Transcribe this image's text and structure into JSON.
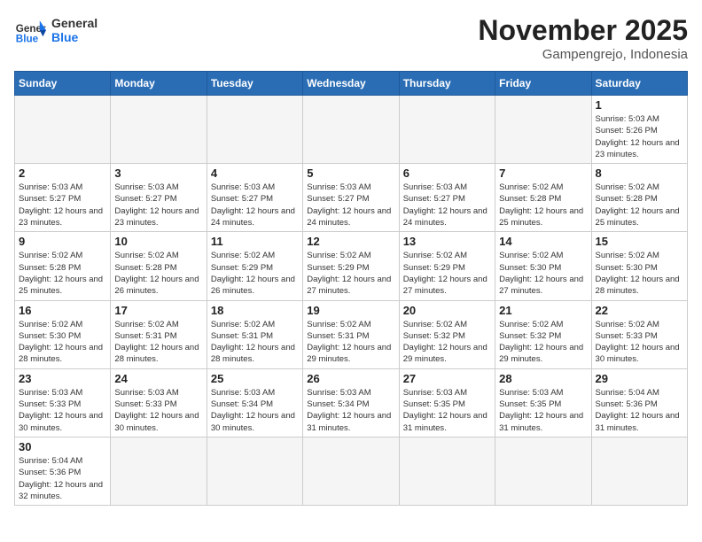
{
  "header": {
    "logo_general": "General",
    "logo_blue": "Blue",
    "month_title": "November 2025",
    "location": "Gampengrejo, Indonesia"
  },
  "days_of_week": [
    "Sunday",
    "Monday",
    "Tuesday",
    "Wednesday",
    "Thursday",
    "Friday",
    "Saturday"
  ],
  "weeks": [
    [
      {
        "day": "",
        "empty": true
      },
      {
        "day": "",
        "empty": true
      },
      {
        "day": "",
        "empty": true
      },
      {
        "day": "",
        "empty": true
      },
      {
        "day": "",
        "empty": true
      },
      {
        "day": "",
        "empty": true
      },
      {
        "day": "1",
        "sunrise": "5:03 AM",
        "sunset": "5:26 PM",
        "daylight": "12 hours and 23 minutes."
      }
    ],
    [
      {
        "day": "2",
        "sunrise": "5:03 AM",
        "sunset": "5:27 PM",
        "daylight": "12 hours and 23 minutes."
      },
      {
        "day": "3",
        "sunrise": "5:03 AM",
        "sunset": "5:27 PM",
        "daylight": "12 hours and 23 minutes."
      },
      {
        "day": "4",
        "sunrise": "5:03 AM",
        "sunset": "5:27 PM",
        "daylight": "12 hours and 24 minutes."
      },
      {
        "day": "5",
        "sunrise": "5:03 AM",
        "sunset": "5:27 PM",
        "daylight": "12 hours and 24 minutes."
      },
      {
        "day": "6",
        "sunrise": "5:03 AM",
        "sunset": "5:27 PM",
        "daylight": "12 hours and 24 minutes."
      },
      {
        "day": "7",
        "sunrise": "5:02 AM",
        "sunset": "5:28 PM",
        "daylight": "12 hours and 25 minutes."
      },
      {
        "day": "8",
        "sunrise": "5:02 AM",
        "sunset": "5:28 PM",
        "daylight": "12 hours and 25 minutes."
      }
    ],
    [
      {
        "day": "9",
        "sunrise": "5:02 AM",
        "sunset": "5:28 PM",
        "daylight": "12 hours and 25 minutes."
      },
      {
        "day": "10",
        "sunrise": "5:02 AM",
        "sunset": "5:28 PM",
        "daylight": "12 hours and 26 minutes."
      },
      {
        "day": "11",
        "sunrise": "5:02 AM",
        "sunset": "5:29 PM",
        "daylight": "12 hours and 26 minutes."
      },
      {
        "day": "12",
        "sunrise": "5:02 AM",
        "sunset": "5:29 PM",
        "daylight": "12 hours and 27 minutes."
      },
      {
        "day": "13",
        "sunrise": "5:02 AM",
        "sunset": "5:29 PM",
        "daylight": "12 hours and 27 minutes."
      },
      {
        "day": "14",
        "sunrise": "5:02 AM",
        "sunset": "5:30 PM",
        "daylight": "12 hours and 27 minutes."
      },
      {
        "day": "15",
        "sunrise": "5:02 AM",
        "sunset": "5:30 PM",
        "daylight": "12 hours and 28 minutes."
      }
    ],
    [
      {
        "day": "16",
        "sunrise": "5:02 AM",
        "sunset": "5:30 PM",
        "daylight": "12 hours and 28 minutes."
      },
      {
        "day": "17",
        "sunrise": "5:02 AM",
        "sunset": "5:31 PM",
        "daylight": "12 hours and 28 minutes."
      },
      {
        "day": "18",
        "sunrise": "5:02 AM",
        "sunset": "5:31 PM",
        "daylight": "12 hours and 28 minutes."
      },
      {
        "day": "19",
        "sunrise": "5:02 AM",
        "sunset": "5:31 PM",
        "daylight": "12 hours and 29 minutes."
      },
      {
        "day": "20",
        "sunrise": "5:02 AM",
        "sunset": "5:32 PM",
        "daylight": "12 hours and 29 minutes."
      },
      {
        "day": "21",
        "sunrise": "5:02 AM",
        "sunset": "5:32 PM",
        "daylight": "12 hours and 29 minutes."
      },
      {
        "day": "22",
        "sunrise": "5:02 AM",
        "sunset": "5:33 PM",
        "daylight": "12 hours and 30 minutes."
      }
    ],
    [
      {
        "day": "23",
        "sunrise": "5:03 AM",
        "sunset": "5:33 PM",
        "daylight": "12 hours and 30 minutes."
      },
      {
        "day": "24",
        "sunrise": "5:03 AM",
        "sunset": "5:33 PM",
        "daylight": "12 hours and 30 minutes."
      },
      {
        "day": "25",
        "sunrise": "5:03 AM",
        "sunset": "5:34 PM",
        "daylight": "12 hours and 30 minutes."
      },
      {
        "day": "26",
        "sunrise": "5:03 AM",
        "sunset": "5:34 PM",
        "daylight": "12 hours and 31 minutes."
      },
      {
        "day": "27",
        "sunrise": "5:03 AM",
        "sunset": "5:35 PM",
        "daylight": "12 hours and 31 minutes."
      },
      {
        "day": "28",
        "sunrise": "5:03 AM",
        "sunset": "5:35 PM",
        "daylight": "12 hours and 31 minutes."
      },
      {
        "day": "29",
        "sunrise": "5:04 AM",
        "sunset": "5:36 PM",
        "daylight": "12 hours and 31 minutes."
      }
    ],
    [
      {
        "day": "30",
        "sunrise": "5:04 AM",
        "sunset": "5:36 PM",
        "daylight": "12 hours and 32 minutes."
      },
      {
        "day": "",
        "empty": true
      },
      {
        "day": "",
        "empty": true
      },
      {
        "day": "",
        "empty": true
      },
      {
        "day": "",
        "empty": true
      },
      {
        "day": "",
        "empty": true
      },
      {
        "day": "",
        "empty": true
      }
    ]
  ]
}
